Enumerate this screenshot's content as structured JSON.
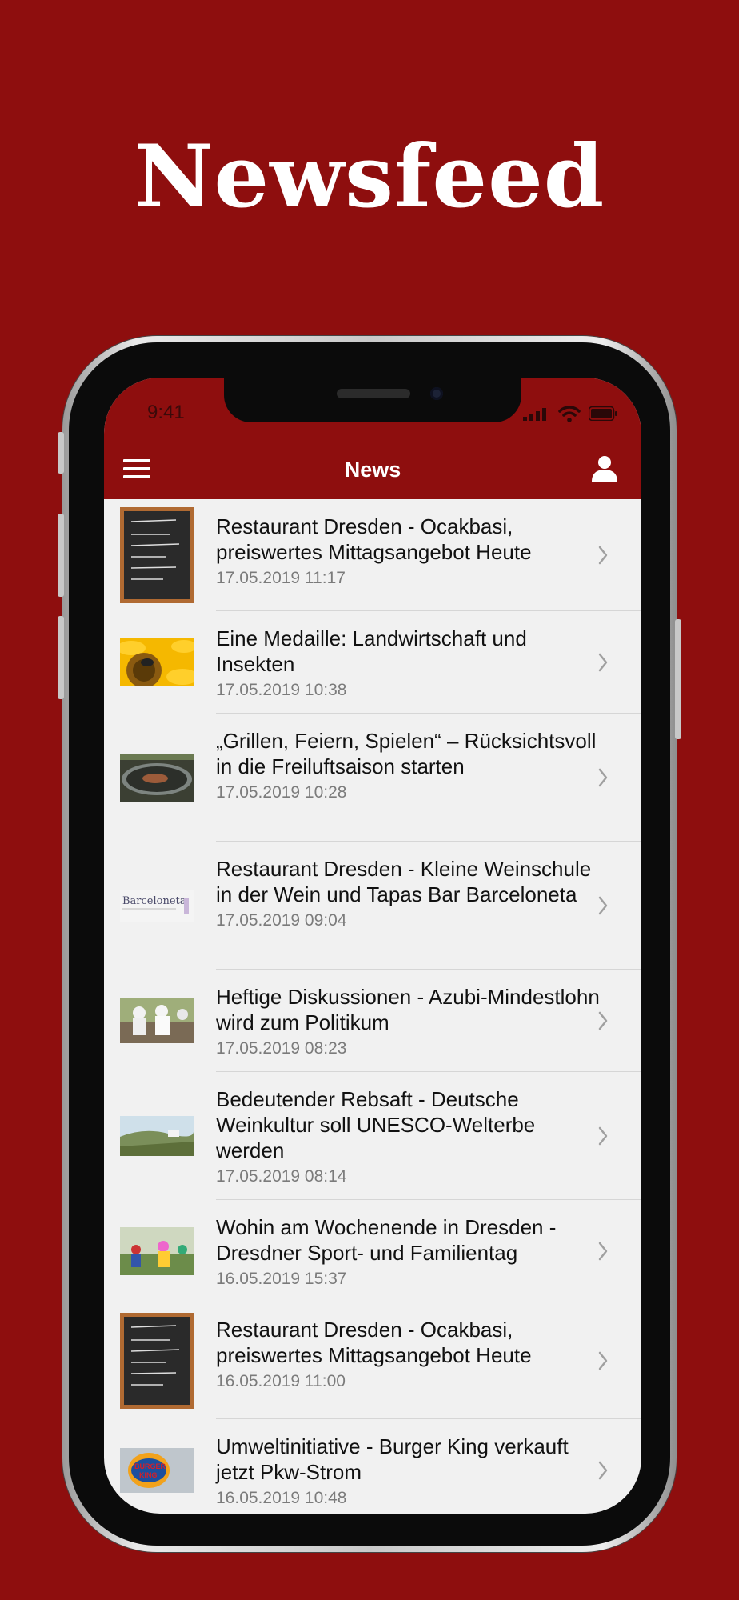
{
  "promo": {
    "headline": "Newsfeed"
  },
  "status_bar": {
    "time": "9:41"
  },
  "nav": {
    "title": "News",
    "menu_icon": "hamburger-menu-icon",
    "profile_icon": "user-profile-icon"
  },
  "news": [
    {
      "title": "Restaurant Dresden - Ocakbasi, preiswertes Mittagsangebot Heute",
      "date": "17.05.2019 11:17",
      "thumb": "chalkboard-menu-thumbnail"
    },
    {
      "title": "Eine Medaille: Landwirtschaft und Insekten",
      "date": "17.05.2019 10:38",
      "thumb": "bee-on-sunflower-thumbnail"
    },
    {
      "title": "„Grillen, Feiern, Spielen“ – Rücksichtsvoll in die Freiluftsaison starten",
      "date": "17.05.2019 10:28",
      "thumb": "grill-thumbnail"
    },
    {
      "title": "Restaurant Dresden - Kleine Weinschule in der Wein und Tapas Bar Barceloneta",
      "date": "17.05.2019 09:04",
      "thumb": "barceloneta-logo-thumbnail"
    },
    {
      "title": "Heftige Diskussionen - Azubi-Mindestlohn wird zum Politikum",
      "date": "17.05.2019 08:23",
      "thumb": "chefs-kitchen-thumbnail"
    },
    {
      "title": "Bedeutender Rebsaft - Deutsche Weinkultur soll UNESCO-Welterbe werden",
      "date": "17.05.2019 08:14",
      "thumb": "vineyard-landscape-thumbnail"
    },
    {
      "title": "Wohin am Wochenende in Dresden - Dresdner Sport- und Familientag",
      "date": "16.05.2019 15:37",
      "thumb": "family-event-thumbnail"
    },
    {
      "title": "Restaurant Dresden - Ocakbasi, preiswertes Mittagsangebot Heute",
      "date": "16.05.2019 11:00",
      "thumb": "chalkboard-menu-thumbnail"
    },
    {
      "title": "Umweltinitiative - Burger King verkauft jetzt Pkw-Strom",
      "date": "16.05.2019 10:48",
      "thumb": "burger-king-sign-thumbnail"
    }
  ],
  "colors": {
    "brand_red": "#8e0e0e",
    "list_bg": "#f1f1f1",
    "date_gray": "#7b7b7b"
  }
}
